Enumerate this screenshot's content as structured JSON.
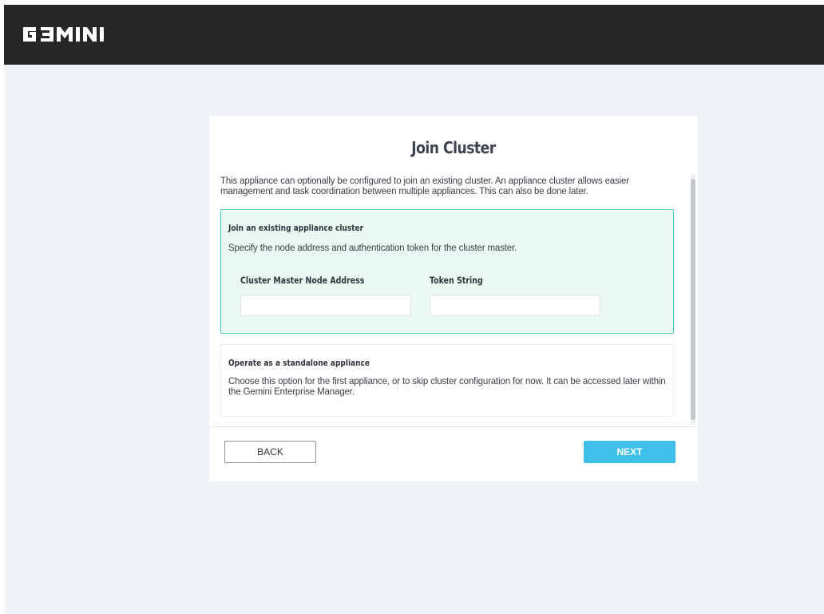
{
  "header": {
    "brand": "GEMINI",
    "bar_color": "#262626"
  },
  "card": {
    "title": "Join Cluster",
    "intro": "This appliance can optionally be configured to join an existing cluster. An appliance cluster allows easier management and task coordination between multiple appliances. This can also be done later."
  },
  "join_option": {
    "title": "Join an existing appliance cluster",
    "description": "Specify the node address and authentication token for the cluster master.",
    "fields": [
      {
        "label": "Cluster Master Node Address",
        "value": "",
        "placeholder": ""
      },
      {
        "label": "Token String",
        "value": "",
        "placeholder": ""
      }
    ],
    "selected": true,
    "accent_color": "#5fd1a5"
  },
  "standalone_option": {
    "title": "Operate as a standalone appliance",
    "description": "Choose this option for the first appliance, or to skip cluster configuration for now. It can be accessed later within the Gemini Enterprise Manager.",
    "selected": false
  },
  "actions": {
    "back_label": "BACK",
    "next_label": "NEXT",
    "next_color": "#3fc0e9"
  }
}
